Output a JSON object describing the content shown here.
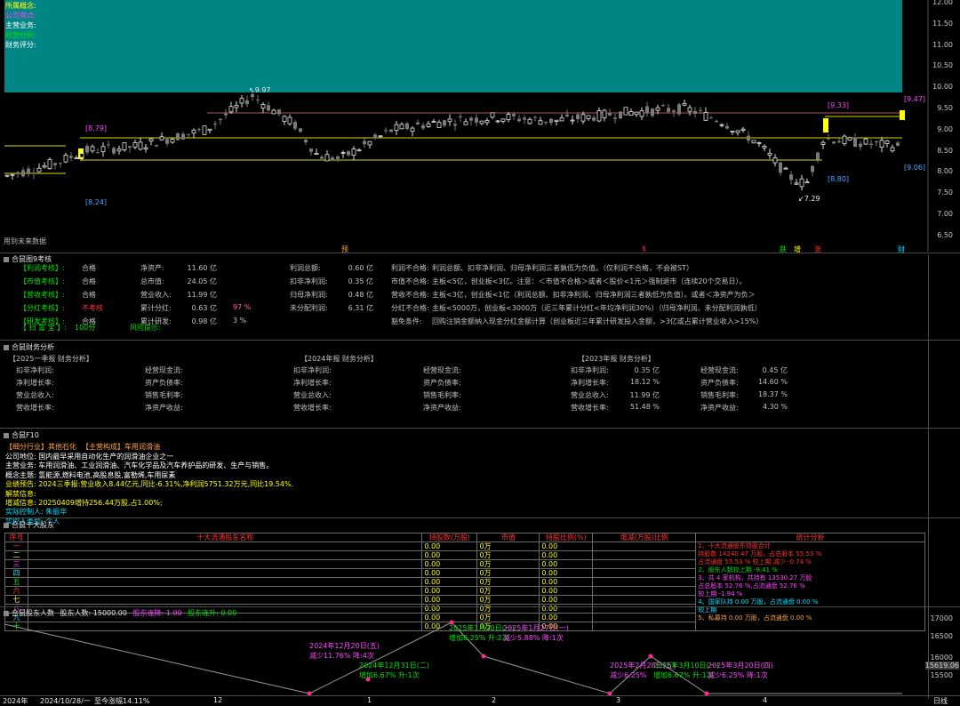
{
  "kline": {
    "info_lines": [
      {
        "text": "所属概念:",
        "color": "#ffff00"
      },
      {
        "text": "公司亮点:",
        "color": "#ff44ff"
      },
      {
        "text": "主营业务:",
        "color": "#ffffff"
      },
      {
        "text": "经营分析:",
        "color": "#00e000"
      },
      {
        "text": "财务评分:",
        "color": "#ffffff"
      }
    ],
    "y_axis": [
      "12.00",
      "11.50",
      "11.00",
      "10.50",
      "10.00",
      "9.50",
      "9.00",
      "8.50",
      "8.00",
      "7.50",
      "7.00",
      "6.50"
    ],
    "price_labels": {
      "high_a": "9.97",
      "low": "7.29",
      "b1": "[8.79]",
      "b2": "[8.24]",
      "b3": "[9.33]",
      "b4": "[9.47]",
      "b5": "[9.06]",
      "b6": "[8.80]"
    },
    "future_note": "用到未来数据",
    "markers": [
      "预",
      "$",
      "跌",
      "增",
      "涨",
      "财"
    ],
    "colors": {
      "cyan_box": "#008585",
      "up": "#e8e8e8",
      "down": "#888888"
    }
  },
  "panel_assess": {
    "title": "合鼠图9考核",
    "rows": [
      {
        "label": "【利润考核】:",
        "status": "合格",
        "k1": "净资产:",
        "v1": "11.60 亿",
        "k2": "利润总额:",
        "v2": "0.60 亿",
        "note_k": "利润不合格:",
        "note": "利润总额、扣非净利润、归母净利润三者孰低为负值。（仅利润不合格，不会被ST）"
      },
      {
        "label": "【市值考核】:",
        "status": "合格",
        "k1": "总市值:",
        "v1": "24.05 亿",
        "k2": "扣非净利润:",
        "v2": "0.35 亿",
        "note_k": "市值不合格:",
        "note": "主板<5亿，创业板<3亿。注意：＜市值不合格＞或者＜股价<1元＞强制退市（连续20个交易日）。"
      },
      {
        "label": "【营收考核】:",
        "status": "合格",
        "k1": "营业收入:",
        "v1": "11.99 亿",
        "k2": "归母净利润:",
        "v2": "0.48 亿",
        "note_k": "营收不合格:",
        "note": "主板<3亿，创业板<1亿（利润总额、扣非净利润、归母净利润三者孰低为负值）。或者＜净资产为负＞"
      },
      {
        "label": "【分红考核】:",
        "status": "不考核",
        "k1": "累计分红:",
        "v1": "0.63 亿",
        "v1b": "97 %",
        "k2": "未分配利润:",
        "v2": "6.31 亿",
        "note_k": "分红不合格:",
        "note": "主板<5000万，创业板<3000万（近三年累计分红<年均净利润30%）（归母净利润、未分配利润孰低）"
      },
      {
        "label": "【研发考核】:",
        "status": "合格",
        "k1": "累计研发:",
        "v1": "0.98 亿",
        "v1b": "3 %",
        "k2": "",
        "v2": "",
        "note_k": "豁免条件:",
        "note": "回购注销金额纳入现金分红金额计算（创业板近三年累计研发投入金额，>3亿或占累计营业收入>15%）"
      }
    ],
    "score_label": "【 扫 雷 宝 】:",
    "score": "100分",
    "risk": "风险提示:"
  },
  "panel_fin": {
    "title": "合鼠财务分析",
    "col_heads": [
      "【2025一季报  财务分析】",
      "【2024年报  财务分析】",
      "【2023年报  财务分析】"
    ],
    "labels_a": [
      "扣非净利润:",
      "净利增长率:",
      "营业总收入:",
      "营收增长率:"
    ],
    "labels_b": [
      "经营现金流:",
      "资产负债率:",
      "销售毛利率:",
      "净资产收益:"
    ],
    "y2023_a": [
      "0.35 亿",
      "18.12 %",
      "11.99 亿",
      "51.48 %"
    ],
    "y2023_b": [
      "0.45 亿",
      "14.60 %",
      "18.37 %",
      "4.30 %"
    ]
  },
  "panel_f10": {
    "title": "合鼠F10",
    "line1_a": "【细分行业】其他石化",
    "line1_b": "【主营构成】车用润滑油",
    "lines": [
      {
        "text": "公司地位: 国内最早采用自动化生产的润滑油企业之一",
        "color": "#ffffff"
      },
      {
        "text": "主营业务: 车用润滑油、工业润滑油、汽车化学品及汽车养护品的研发、生产与销售。",
        "color": "#ffffff"
      },
      {
        "text": "概念主题: 氢能源,燃料电池,高股息股,富勒烯,车用尿素",
        "color": "#ffffff"
      },
      {
        "text": "业绩预告: 2024三季报:营业收入8.44亿元,同比-6.31%,净利润5751.32万元,同比19.54%.",
        "color": "#ffff00"
      },
      {
        "text": "解禁信息:",
        "color": "#ffff00"
      },
      {
        "text": "增减信息: 20250409增持256.44万股,占1.00%;",
        "color": "#ffff00"
      },
      {
        "text": "实际控制人: 朱振华",
        "color": "#00e0ff"
      },
      {
        "text": "实控人类型: 个人",
        "color": "#00e0ff"
      }
    ]
  },
  "panel_holders": {
    "title": "合鼠十大股东",
    "headers": [
      "序号",
      "十大流通股东名称",
      "持股数(万股)",
      "市值",
      "持股比例(%)",
      "增减(万股)比例",
      "统计分析"
    ],
    "rows": [
      {
        "no": "一",
        "shares": "0.00",
        "mv": "0万",
        "pct": "0.00"
      },
      {
        "no": "二",
        "shares": "0.00",
        "mv": "0万",
        "pct": "0.00"
      },
      {
        "no": "三",
        "shares": "0.00",
        "mv": "0万",
        "pct": "0.00"
      },
      {
        "no": "四",
        "shares": "0.00",
        "mv": "0万",
        "pct": "0.00"
      },
      {
        "no": "五",
        "shares": "0.00",
        "mv": "0万",
        "pct": "0.00"
      },
      {
        "no": "六",
        "shares": "0.00",
        "mv": "0万",
        "pct": "0.00"
      },
      {
        "no": "七",
        "shares": "0.00",
        "mv": "0万",
        "pct": "0.00"
      },
      {
        "no": "八",
        "shares": "0.00",
        "mv": "0万",
        "pct": "0.00"
      },
      {
        "no": "九",
        "shares": "0.00",
        "mv": "0万",
        "pct": "0.00"
      },
      {
        "no": "十",
        "shares": "0.00",
        "mv": "0万",
        "pct": "0.00"
      }
    ],
    "stats": [
      {
        "text": "1、十大流通股东持股合计",
        "color": "#ff3030"
      },
      {
        "text": "持股数 14240.47 万股，占总股本 55.53 %",
        "color": "#ff3030"
      },
      {
        "text": "占流通盘 55.53 % 较上期 减少 -0.74 %",
        "color": "#ff3030"
      },
      {
        "text": "2、股东人数较上期 -9.41 %",
        "color": "#00e000"
      },
      {
        "text": "3、共 4 家机构，共持有 13530.27 万股",
        "color": "#ff44ff"
      },
      {
        "text": "占总股本 52.76 %,占流通盘 52.76 %",
        "color": "#ff44ff"
      },
      {
        "text": "较上期 -1.94 %",
        "color": "#ff44ff"
      },
      {
        "text": "4、国家队持 0.00 万股，占流通盘 0.00 %",
        "color": "#00e0ff"
      },
      {
        "text": "较上期",
        "color": "#00e0ff"
      },
      {
        "text": "5、私募持 0.00 万股，占流通盘 0.00 %",
        "color": "#ffa040"
      }
    ]
  },
  "panel_people": {
    "title_a": "合鼠股东人数",
    "title_b": "股东人数: 15000.00",
    "title_c": "股东连降: 1.00",
    "title_d": "股东连升: 0.00",
    "y_axis": [
      "17000",
      "16500",
      "16000",
      "15619.06",
      "15500"
    ],
    "annotations": [
      {
        "l1": "2024年12月20日(五)",
        "l2": "减少11.76%  降:4次",
        "color": "#ff44ff"
      },
      {
        "l1": "2024年12月31日(二)",
        "l2": "增加6.67%  升:1次",
        "color": "#00e000"
      },
      {
        "l1": "2025年1月20日(一)",
        "l2": "增加6.25%  升:2次",
        "color": "#00e000"
      },
      {
        "l1": "2025年1月27日(一)",
        "l2": "减少5.88%  降:1次",
        "color": "#ff44ff"
      },
      {
        "l1": "2025年2月28日(五)",
        "l2": "减少6.25%",
        "color": "#ff44ff"
      },
      {
        "l1": "2025年3月10日(一)",
        "l2": "增加6.67%  升:1次",
        "color": "#00e000"
      },
      {
        "l1": "2025年3月20日(四)",
        "l2": "减少6.25%  降:1次",
        "color": "#ff44ff"
      }
    ]
  },
  "bottom_axis": {
    "year": "2024年",
    "date": "2024/10/28/一",
    "change": "至今涨幅14.11%",
    "ticks": [
      "12",
      "1",
      "2",
      "3",
      "4"
    ],
    "period": "日线"
  }
}
